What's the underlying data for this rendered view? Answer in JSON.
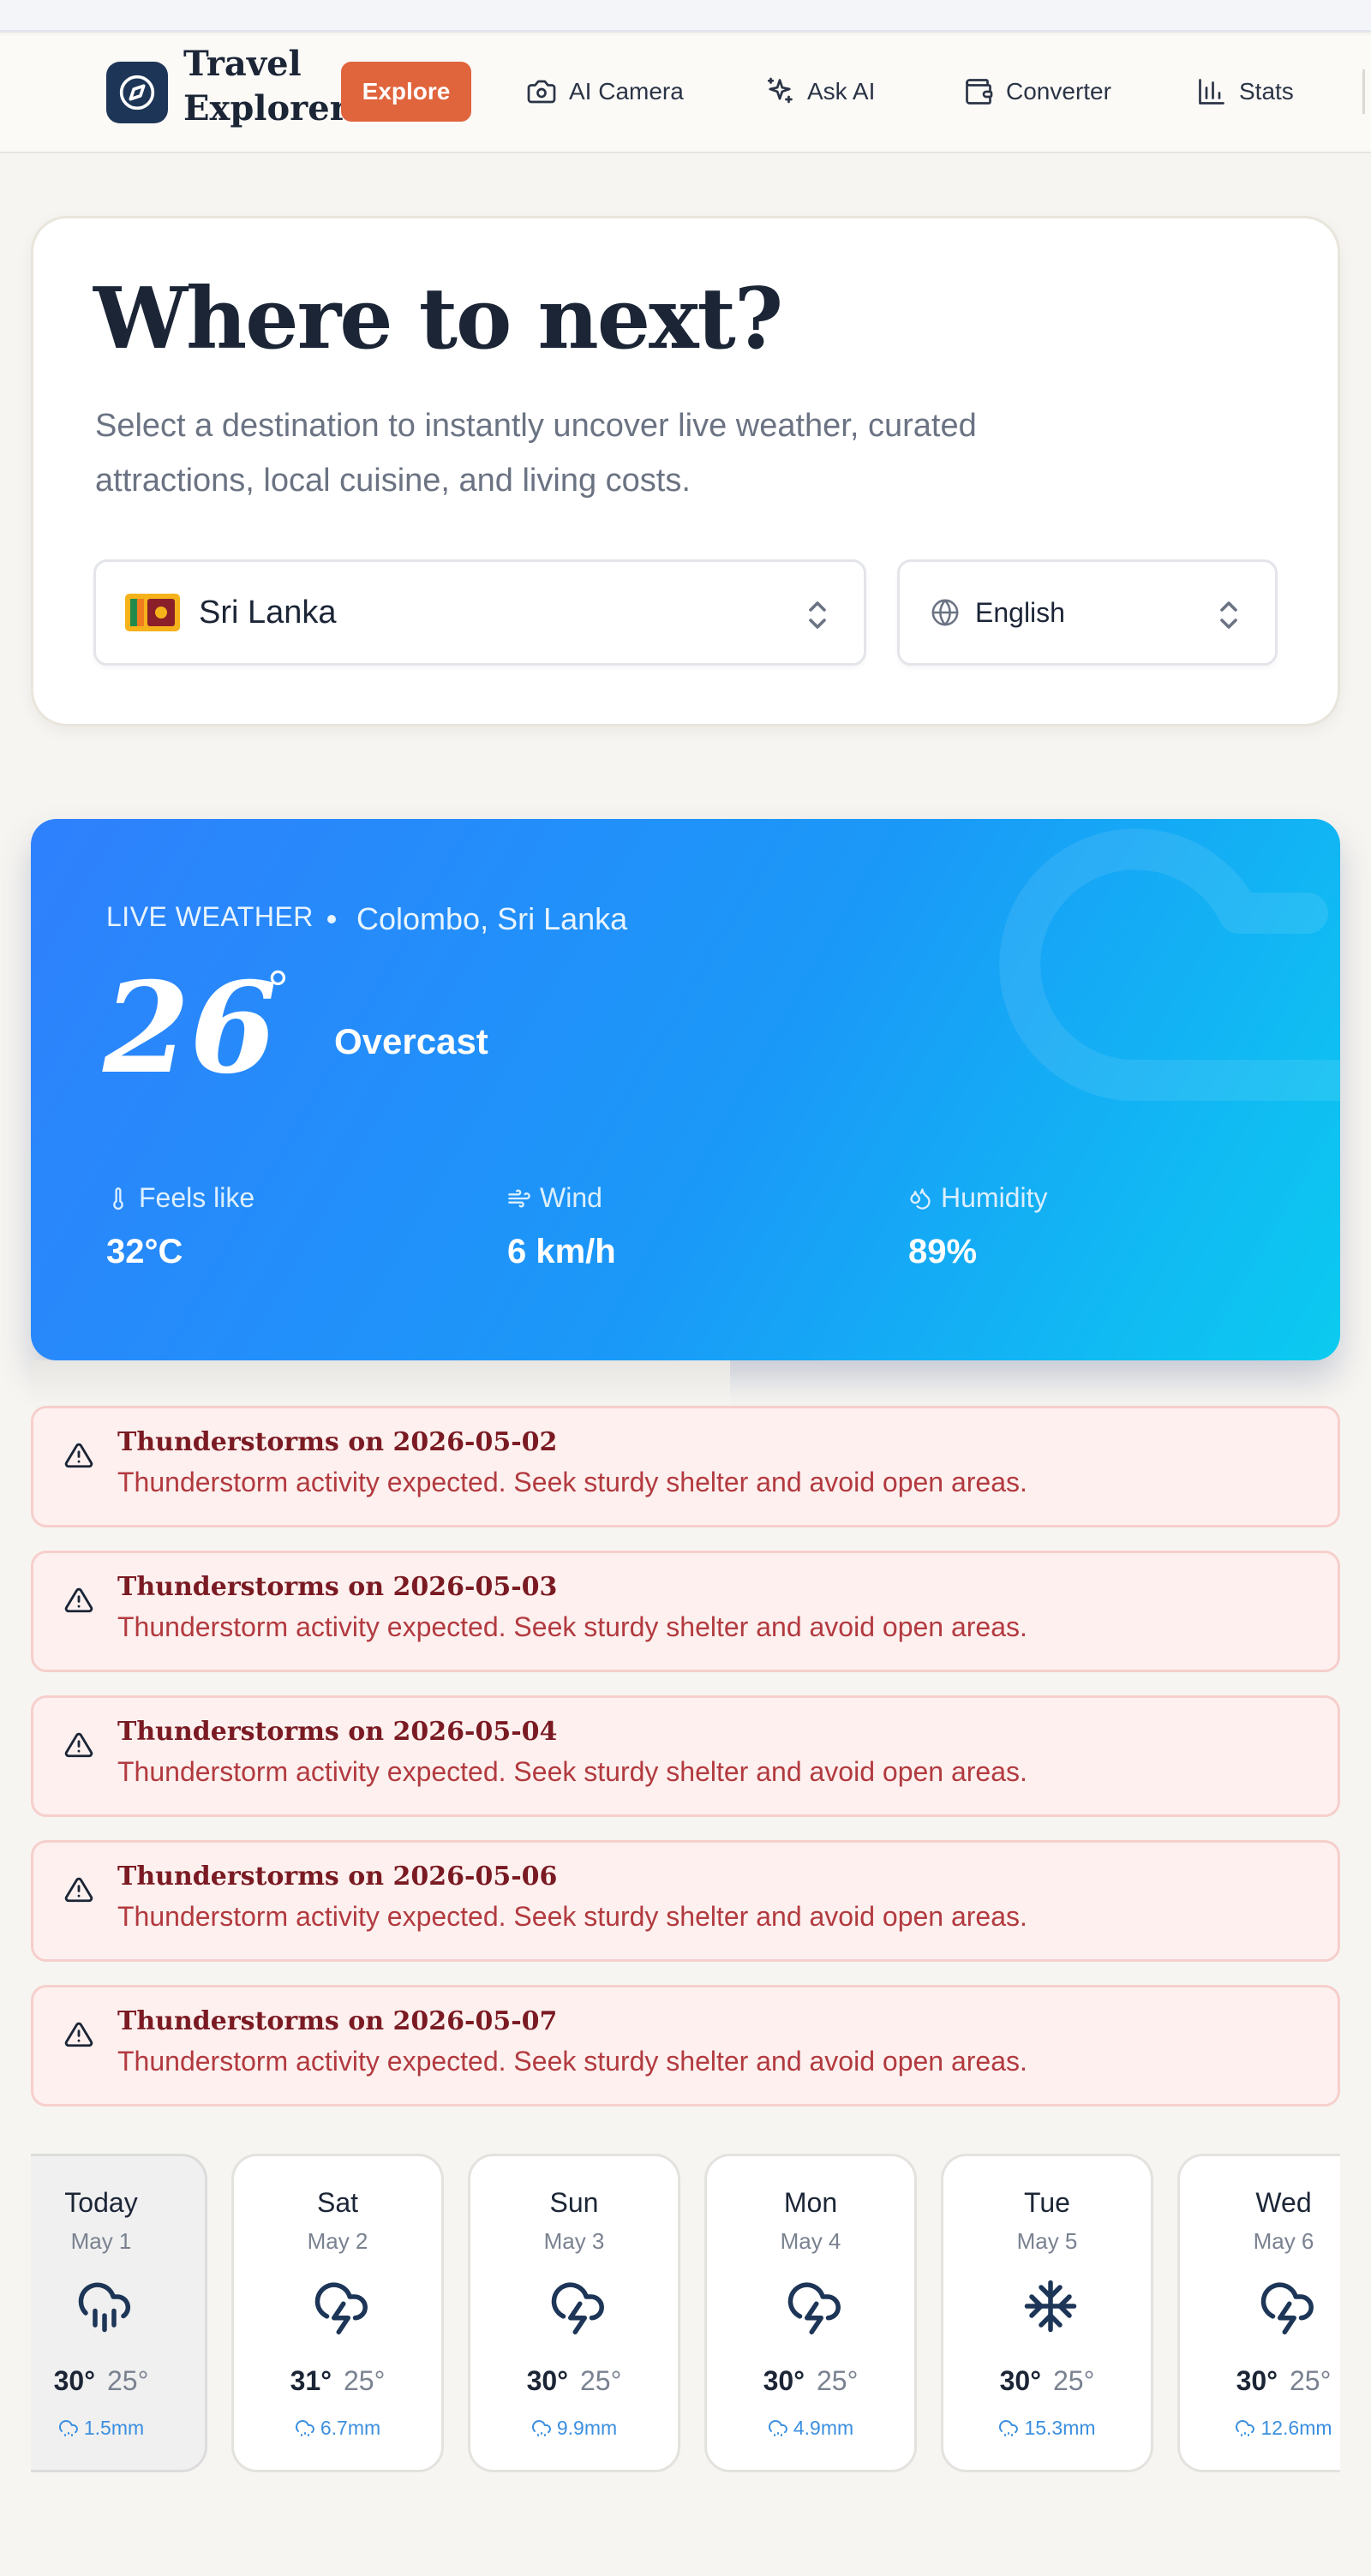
{
  "nav": {
    "brand": "Travel Explorer",
    "items": [
      {
        "label": "Explore",
        "icon": "explore-compass-icon",
        "active": true
      },
      {
        "label": "AI Camera",
        "icon": "camera-icon"
      },
      {
        "label": "Ask AI",
        "icon": "sparkles-icon"
      },
      {
        "label": "Converter",
        "icon": "wallet-icon"
      },
      {
        "label": "Stats",
        "icon": "bar-chart-icon"
      }
    ]
  },
  "hero": {
    "title": "Where to next?",
    "subtitle": "Select a destination to instantly uncover live weather, curated attractions, local cuisine, and living costs.",
    "country": {
      "value": "Sri Lanka",
      "flag": "sri-lanka-flag-icon"
    },
    "language": {
      "value": "English",
      "icon": "globe-icon"
    }
  },
  "weather": {
    "label": "LIVE WEATHER",
    "location": "Colombo, Sri Lanka",
    "temp": "26",
    "degree": "°",
    "condition": "Overcast",
    "stats": [
      {
        "label": "Feels like",
        "value": "32°C",
        "icon": "thermometer-icon"
      },
      {
        "label": "Wind",
        "value": "6 km/h",
        "icon": "wind-icon"
      },
      {
        "label": "Humidity",
        "value": "89%",
        "icon": "droplets-icon"
      }
    ]
  },
  "alerts": [
    {
      "title": "Thunderstorms on 2026-05-02",
      "text": "Thunderstorm activity expected. Seek sturdy shelter and avoid open areas."
    },
    {
      "title": "Thunderstorms on 2026-05-03",
      "text": "Thunderstorm activity expected. Seek sturdy shelter and avoid open areas."
    },
    {
      "title": "Thunderstorms on 2026-05-04",
      "text": "Thunderstorm activity expected. Seek sturdy shelter and avoid open areas."
    },
    {
      "title": "Thunderstorms on 2026-05-06",
      "text": "Thunderstorm activity expected. Seek sturdy shelter and avoid open areas."
    },
    {
      "title": "Thunderstorms on 2026-05-07",
      "text": "Thunderstorm activity expected. Seek sturdy shelter and avoid open areas."
    }
  ],
  "forecast": [
    {
      "day": "Today",
      "date": "May 1",
      "hi": "30°",
      "lo": "25°",
      "rain": "1.5mm",
      "icon": "cloud-rain-icon"
    },
    {
      "day": "Sat",
      "date": "May 2",
      "hi": "31°",
      "lo": "25°",
      "rain": "6.7mm",
      "icon": "cloud-lightning-icon"
    },
    {
      "day": "Sun",
      "date": "May 3",
      "hi": "30°",
      "lo": "25°",
      "rain": "9.9mm",
      "icon": "cloud-lightning-icon"
    },
    {
      "day": "Mon",
      "date": "May 4",
      "hi": "30°",
      "lo": "25°",
      "rain": "4.9mm",
      "icon": "cloud-lightning-icon"
    },
    {
      "day": "Tue",
      "date": "May 5",
      "hi": "30°",
      "lo": "25°",
      "rain": "15.3mm",
      "icon": "snowflake-icon"
    },
    {
      "day": "Wed",
      "date": "May 6",
      "hi": "30°",
      "lo": "25°",
      "rain": "12.6mm",
      "icon": "cloud-lightning-icon"
    }
  ],
  "colors": {
    "accent": "#e0643c",
    "brand_dark": "#1d3557",
    "weather_gradient_start": "#2f80fc",
    "weather_gradient_end": "#0bcbf0",
    "alert_bg": "#fdf0ef",
    "alert_border": "#f6cfcc",
    "alert_title": "#7a1a22",
    "alert_text": "#b23a3f",
    "rain_blue": "#3b8fe0"
  }
}
